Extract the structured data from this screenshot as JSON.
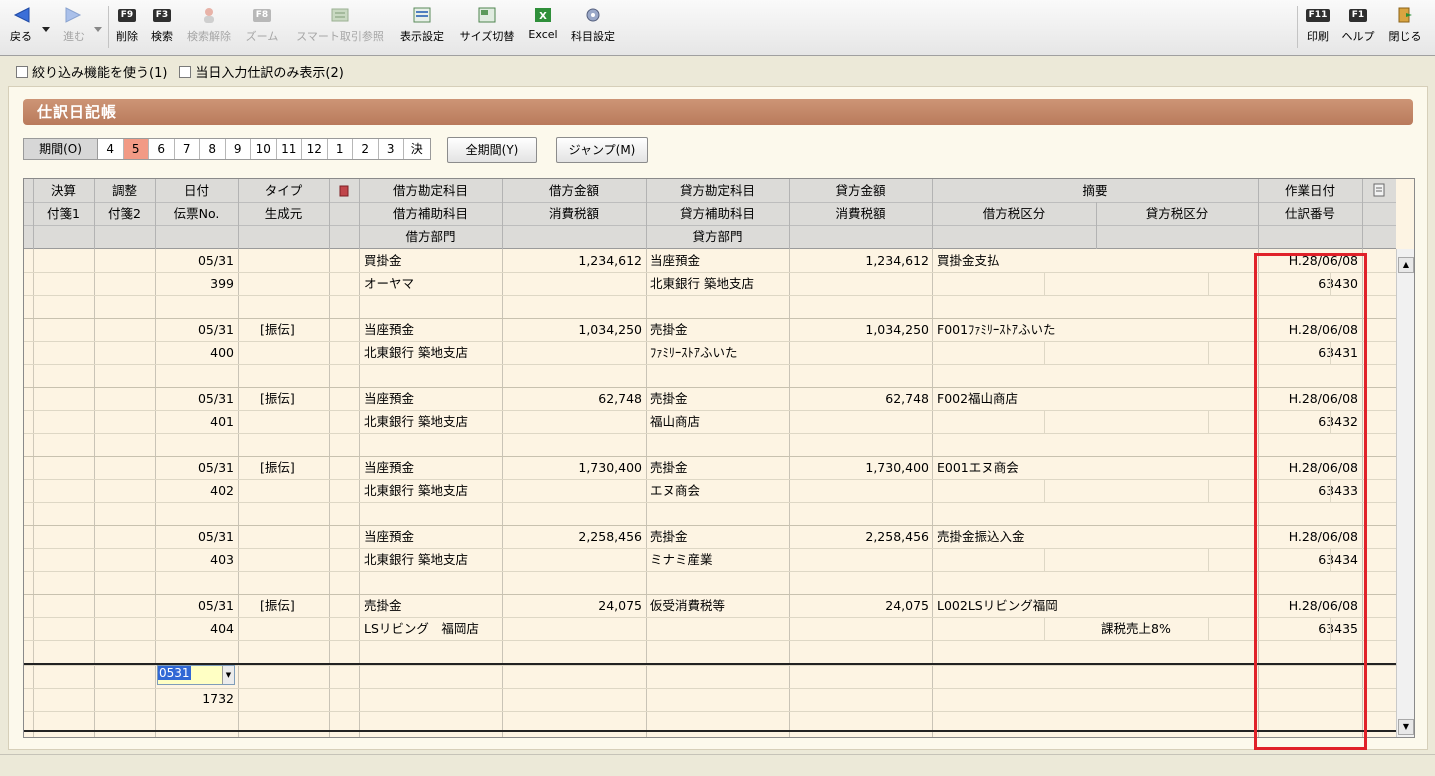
{
  "toolbar": {
    "back": "戻る",
    "forward": "進む",
    "delete": "削除",
    "search": "検索",
    "release": "検索解除",
    "zoom": "ズーム",
    "smart": "スマート取引参照",
    "display": "表示設定",
    "size": "サイズ切替",
    "excel": "Excel",
    "account": "科目設定",
    "print": "印刷",
    "help": "ヘルプ",
    "close": "閉じる",
    "keys": {
      "delete": "F9",
      "search": "F3",
      "zoom": "F8",
      "print": "F11",
      "help": "F1"
    }
  },
  "options": {
    "filter": "絞り込み機能を使う(1)",
    "today": "当日入力仕訳のみ表示(2)"
  },
  "panel": {
    "title": "仕訳日記帳"
  },
  "period": {
    "label": "期間(O)",
    "months": [
      "4",
      "5",
      "6",
      "7",
      "8",
      "9",
      "10",
      "11",
      "12",
      "1",
      "2",
      "3",
      "決"
    ],
    "active": "5",
    "all_button": "全期間(Y)",
    "jump_button": "ジャンプ(M)"
  },
  "header": {
    "r1": [
      "決算",
      "調整",
      "日付",
      "タイプ",
      "借方勘定科目",
      "借方金額",
      "貸方勘定科目",
      "貸方金額",
      "摘要",
      "作業日付"
    ],
    "r2": [
      "付箋1",
      "付箋2",
      "伝票No.",
      "生成元",
      "借方補助科目",
      "消費税額",
      "貸方補助科目",
      "消費税額",
      "借方税区分",
      "貸方税区分",
      "仕訳番号"
    ],
    "r3": [
      "借方部門",
      "貸方部門"
    ]
  },
  "entries": [
    {
      "date": "05/31",
      "no": "399",
      "type": "",
      "dr_acct": "買掛金",
      "dr_amt": "1,234,612",
      "cr_acct": "当座預金",
      "cr_amt": "1,234,612",
      "memo": "買掛金支払",
      "dr_sub": "オーヤマ",
      "cr_sub": "北東銀行 築地支店",
      "cr_tax": "",
      "work_date": "H.28/06/08",
      "jnl_no": "63430"
    },
    {
      "date": "05/31",
      "no": "400",
      "type": "[振伝]",
      "dr_acct": "当座預金",
      "dr_amt": "1,034,250",
      "cr_acct": "売掛金",
      "cr_amt": "1,034,250",
      "memo": "F001ﾌｧﾐﾘｰｽﾄｱふいた",
      "dr_sub": "北東銀行 築地支店",
      "cr_sub": "ﾌｧﾐﾘｰｽﾄｱふいた",
      "cr_tax": "",
      "work_date": "H.28/06/08",
      "jnl_no": "63431"
    },
    {
      "date": "05/31",
      "no": "401",
      "type": "[振伝]",
      "dr_acct": "当座預金",
      "dr_amt": "62,748",
      "cr_acct": "売掛金",
      "cr_amt": "62,748",
      "memo": "F002福山商店",
      "dr_sub": "北東銀行 築地支店",
      "cr_sub": "福山商店",
      "cr_tax": "",
      "work_date": "H.28/06/08",
      "jnl_no": "63432"
    },
    {
      "date": "05/31",
      "no": "402",
      "type": "[振伝]",
      "dr_acct": "当座預金",
      "dr_amt": "1,730,400",
      "cr_acct": "売掛金",
      "cr_amt": "1,730,400",
      "memo": "E001エヌ商会",
      "dr_sub": "北東銀行 築地支店",
      "cr_sub": "エヌ商会",
      "cr_tax": "",
      "work_date": "H.28/06/08",
      "jnl_no": "63433"
    },
    {
      "date": "05/31",
      "no": "403",
      "type": "",
      "dr_acct": "当座預金",
      "dr_amt": "2,258,456",
      "cr_acct": "売掛金",
      "cr_amt": "2,258,456",
      "memo": "売掛金振込入金",
      "dr_sub": "北東銀行 築地支店",
      "cr_sub": "ミナミ産業",
      "cr_tax": "",
      "work_date": "H.28/06/08",
      "jnl_no": "63434"
    },
    {
      "date": "05/31",
      "no": "404",
      "type": "[振伝]",
      "dr_acct": "売掛金",
      "dr_amt": "24,075",
      "cr_acct": "仮受消費税等",
      "cr_amt": "24,075",
      "memo": "L002LSリビング福岡",
      "dr_sub": "LSリビング　福岡店",
      "cr_sub": "",
      "cr_tax": "課税売上8%",
      "work_date": "H.28/06/08",
      "jnl_no": "63435"
    }
  ],
  "new_entry": {
    "date_input": "0531",
    "no": "1732"
  },
  "colors": {
    "title": "#c0836a",
    "highlight": "#e0222a",
    "active_month": "#f29a85"
  }
}
